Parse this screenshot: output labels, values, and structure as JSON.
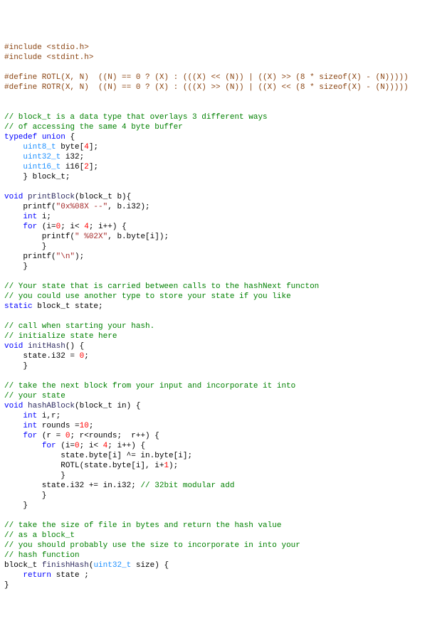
{
  "lines": [
    [
      {
        "c": "preproc",
        "t": "#include <stdio.h>"
      }
    ],
    [
      {
        "c": "preproc",
        "t": "#include <stdint.h>"
      }
    ],
    [
      {
        "c": "plain",
        "t": ""
      }
    ],
    [
      {
        "c": "preproc",
        "t": "#define ROTL(X, N)  ((N) == 0 ? (X) : (((X) << (N)) | ((X) >> (8 * sizeof(X) - (N)))))"
      }
    ],
    [
      {
        "c": "preproc",
        "t": "#define ROTR(X, N)  ((N) == 0 ? (X) : (((X) >> (N)) | ((X) << (8 * sizeof(X) - (N)))))"
      }
    ],
    [
      {
        "c": "plain",
        "t": ""
      }
    ],
    [
      {
        "c": "plain",
        "t": ""
      }
    ],
    [
      {
        "c": "comment",
        "t": "// block_t is a data type that overlays 3 different ways"
      }
    ],
    [
      {
        "c": "comment",
        "t": "// of accessing the same 4 byte buffer"
      }
    ],
    [
      {
        "c": "keyword",
        "t": "typedef"
      },
      {
        "c": "plain",
        "t": " "
      },
      {
        "c": "keyword",
        "t": "union"
      },
      {
        "c": "plain",
        "t": " {"
      }
    ],
    [
      {
        "c": "plain",
        "t": "    "
      },
      {
        "c": "type",
        "t": "uint8_t"
      },
      {
        "c": "plain",
        "t": " byte["
      },
      {
        "c": "num",
        "t": "4"
      },
      {
        "c": "plain",
        "t": "];"
      }
    ],
    [
      {
        "c": "plain",
        "t": "    "
      },
      {
        "c": "type",
        "t": "uint32_t"
      },
      {
        "c": "plain",
        "t": " i32;"
      }
    ],
    [
      {
        "c": "plain",
        "t": "    "
      },
      {
        "c": "type",
        "t": "uint16_t"
      },
      {
        "c": "plain",
        "t": " i16["
      },
      {
        "c": "num",
        "t": "2"
      },
      {
        "c": "plain",
        "t": "];"
      }
    ],
    [
      {
        "c": "plain",
        "t": "    } block_t;"
      }
    ],
    [
      {
        "c": "plain",
        "t": ""
      }
    ],
    [
      {
        "c": "keyword",
        "t": "void"
      },
      {
        "c": "plain",
        "t": " "
      },
      {
        "c": "func",
        "t": "printBlock"
      },
      {
        "c": "plain",
        "t": "(block_t b){"
      }
    ],
    [
      {
        "c": "plain",
        "t": "    printf("
      },
      {
        "c": "str",
        "t": "\"0x%08X --\""
      },
      {
        "c": "plain",
        "t": ", b.i32);"
      }
    ],
    [
      {
        "c": "plain",
        "t": "    "
      },
      {
        "c": "keyword",
        "t": "int"
      },
      {
        "c": "plain",
        "t": " i;"
      }
    ],
    [
      {
        "c": "plain",
        "t": "    "
      },
      {
        "c": "keyword",
        "t": "for"
      },
      {
        "c": "plain",
        "t": " (i="
      },
      {
        "c": "num",
        "t": "0"
      },
      {
        "c": "plain",
        "t": "; i< "
      },
      {
        "c": "num",
        "t": "4"
      },
      {
        "c": "plain",
        "t": "; i++) {"
      }
    ],
    [
      {
        "c": "plain",
        "t": "        printf("
      },
      {
        "c": "str",
        "t": "\" %02X\""
      },
      {
        "c": "plain",
        "t": ", b.byte[i]);"
      }
    ],
    [
      {
        "c": "plain",
        "t": "        }"
      }
    ],
    [
      {
        "c": "plain",
        "t": "    printf("
      },
      {
        "c": "str",
        "t": "\"\\n\""
      },
      {
        "c": "plain",
        "t": ");"
      }
    ],
    [
      {
        "c": "plain",
        "t": "    }"
      }
    ],
    [
      {
        "c": "plain",
        "t": ""
      }
    ],
    [
      {
        "c": "comment",
        "t": "// Your state that is carried between calls to the hashNext functon"
      }
    ],
    [
      {
        "c": "comment",
        "t": "// you could use another type to store your state if you like"
      }
    ],
    [
      {
        "c": "keyword",
        "t": "static"
      },
      {
        "c": "plain",
        "t": " block_t state;"
      }
    ],
    [
      {
        "c": "plain",
        "t": ""
      }
    ],
    [
      {
        "c": "comment",
        "t": "// call when starting your hash."
      }
    ],
    [
      {
        "c": "comment",
        "t": "// initialize state here"
      }
    ],
    [
      {
        "c": "keyword",
        "t": "void"
      },
      {
        "c": "plain",
        "t": " "
      },
      {
        "c": "func",
        "t": "initHash"
      },
      {
        "c": "plain",
        "t": "() {"
      }
    ],
    [
      {
        "c": "plain",
        "t": "    state.i32 = "
      },
      {
        "c": "num",
        "t": "0"
      },
      {
        "c": "plain",
        "t": ";"
      }
    ],
    [
      {
        "c": "plain",
        "t": "    }"
      }
    ],
    [
      {
        "c": "plain",
        "t": ""
      }
    ],
    [
      {
        "c": "comment",
        "t": "// take the next block from your input and incorporate it into"
      }
    ],
    [
      {
        "c": "comment",
        "t": "// your state"
      }
    ],
    [
      {
        "c": "keyword",
        "t": "void"
      },
      {
        "c": "plain",
        "t": " "
      },
      {
        "c": "func",
        "t": "hashABlock"
      },
      {
        "c": "plain",
        "t": "(block_t in) {"
      }
    ],
    [
      {
        "c": "plain",
        "t": "    "
      },
      {
        "c": "keyword",
        "t": "int"
      },
      {
        "c": "plain",
        "t": " i,r;"
      }
    ],
    [
      {
        "c": "plain",
        "t": "    "
      },
      {
        "c": "keyword",
        "t": "int"
      },
      {
        "c": "plain",
        "t": " rounds ="
      },
      {
        "c": "num",
        "t": "10"
      },
      {
        "c": "plain",
        "t": ";"
      }
    ],
    [
      {
        "c": "plain",
        "t": "    "
      },
      {
        "c": "keyword",
        "t": "for"
      },
      {
        "c": "plain",
        "t": " (r = "
      },
      {
        "c": "num",
        "t": "0"
      },
      {
        "c": "plain",
        "t": "; r<rounds;  r++) {"
      }
    ],
    [
      {
        "c": "plain",
        "t": "        "
      },
      {
        "c": "keyword",
        "t": "for"
      },
      {
        "c": "plain",
        "t": " (i="
      },
      {
        "c": "num",
        "t": "0"
      },
      {
        "c": "plain",
        "t": "; i< "
      },
      {
        "c": "num",
        "t": "4"
      },
      {
        "c": "plain",
        "t": "; i++) {"
      }
    ],
    [
      {
        "c": "plain",
        "t": "            state.byte[i] ^= in.byte[i];"
      }
    ],
    [
      {
        "c": "plain",
        "t": "            ROTL(state.byte[i], i+"
      },
      {
        "c": "num",
        "t": "1"
      },
      {
        "c": "plain",
        "t": ");"
      }
    ],
    [
      {
        "c": "plain",
        "t": "            }"
      }
    ],
    [
      {
        "c": "plain",
        "t": "        state.i32 += in.i32; "
      },
      {
        "c": "comment",
        "t": "// 32bit modular add"
      }
    ],
    [
      {
        "c": "plain",
        "t": "        }"
      }
    ],
    [
      {
        "c": "plain",
        "t": "    }"
      }
    ],
    [
      {
        "c": "plain",
        "t": ""
      }
    ],
    [
      {
        "c": "comment",
        "t": "// take the size of file in bytes and return the hash value"
      }
    ],
    [
      {
        "c": "comment",
        "t": "// as a block_t"
      }
    ],
    [
      {
        "c": "comment",
        "t": "// you should probably use the size to incorporate in into your"
      }
    ],
    [
      {
        "c": "comment",
        "t": "// hash function"
      }
    ],
    [
      {
        "c": "plain",
        "t": "block_t "
      },
      {
        "c": "func",
        "t": "finishHash"
      },
      {
        "c": "plain",
        "t": "("
      },
      {
        "c": "type",
        "t": "uint32_t"
      },
      {
        "c": "plain",
        "t": " size) {"
      }
    ],
    [
      {
        "c": "plain",
        "t": "    "
      },
      {
        "c": "keyword",
        "t": "return"
      },
      {
        "c": "plain",
        "t": " state ;"
      }
    ],
    [
      {
        "c": "plain",
        "t": "}"
      }
    ]
  ]
}
